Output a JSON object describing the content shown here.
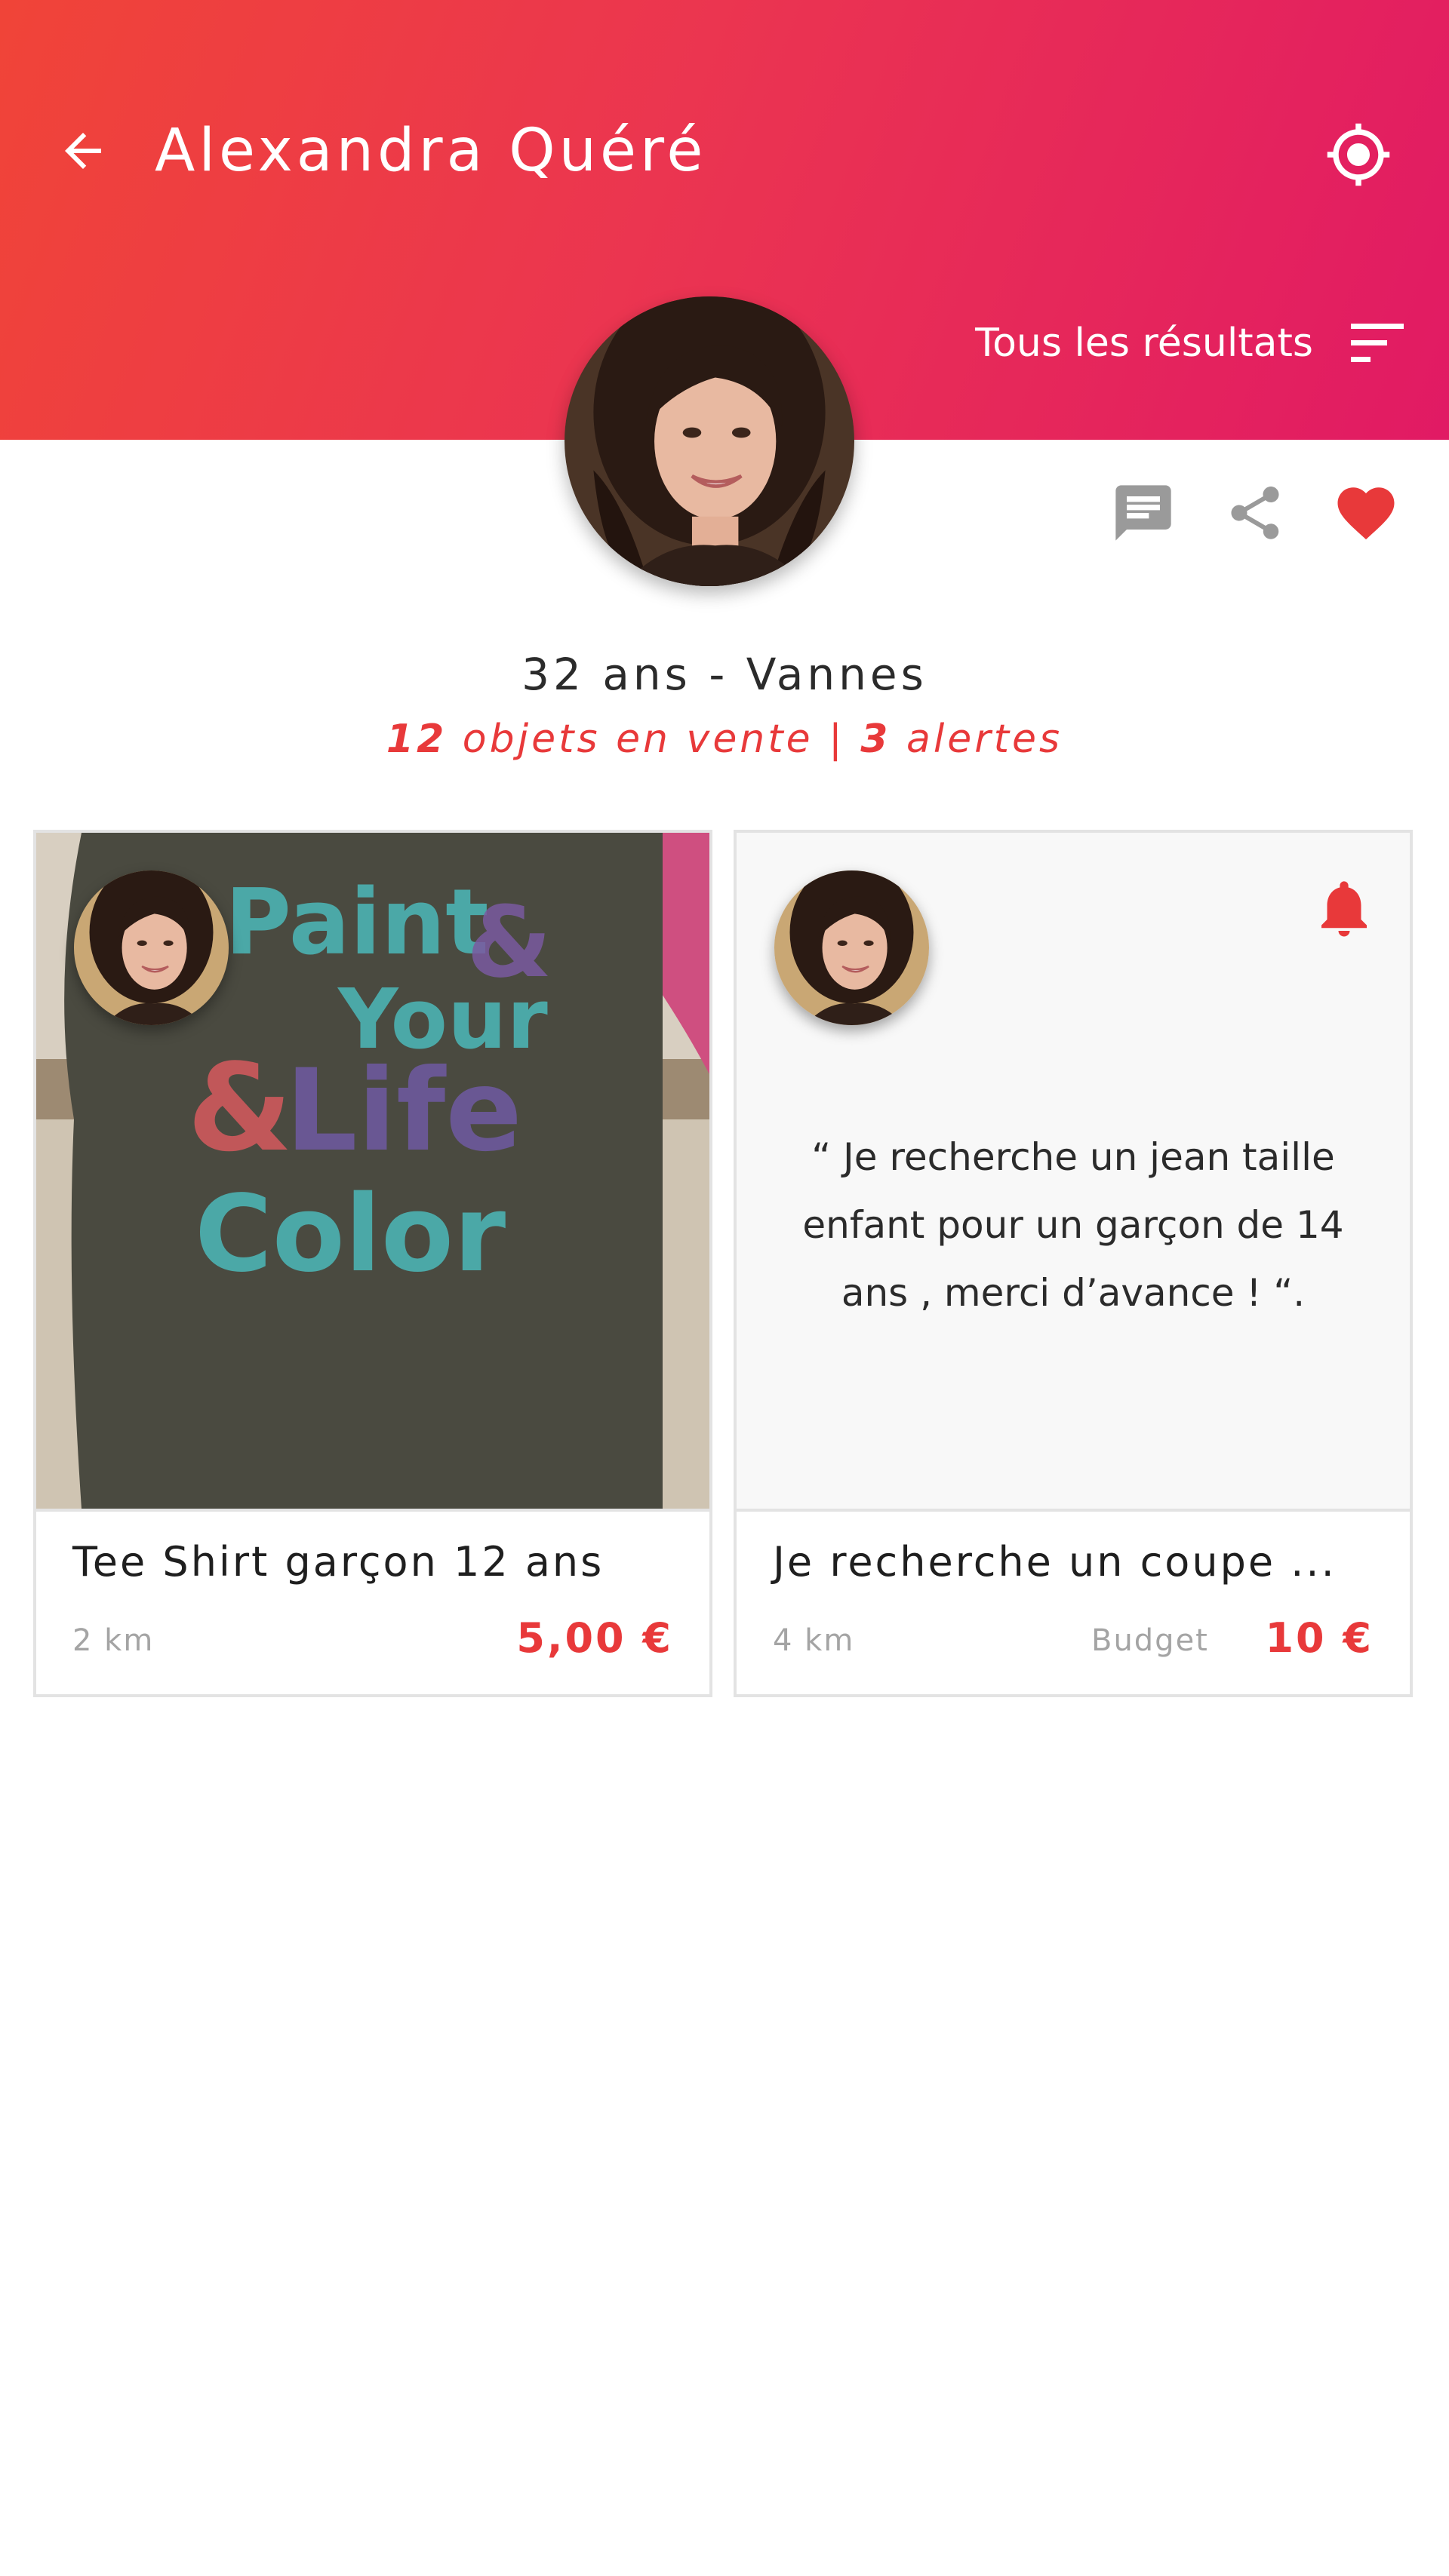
{
  "header": {
    "title": "Alexandra Quéré",
    "filter_label": "Tous les résultats",
    "icons": {
      "back": "arrow-left-icon",
      "locate": "my-location-icon",
      "filter": "sort-lines-icon"
    }
  },
  "profile": {
    "age_city": "32 ans - Vannes",
    "items_count": "12",
    "items_label": " objets en vente | ",
    "alerts_count": "3",
    "alerts_label": " alertes"
  },
  "actions": [
    {
      "name": "message",
      "icon": "message-icon"
    },
    {
      "name": "share",
      "icon": "share-icon"
    },
    {
      "name": "favorite",
      "icon": "heart-icon"
    }
  ],
  "cards": [
    {
      "type": "item",
      "media_text": [
        "Paint",
        "&",
        "Your",
        "Life",
        "Color"
      ],
      "title": "Tee Shirt garçon 12 ans",
      "distance": "2 km",
      "price": "5,00 €"
    },
    {
      "type": "alert",
      "quote": "“ Je recherche un jean taille enfant pour un garçon de 14 ans , merci d’avance ! “.",
      "title": "Je recherche un coupe ...",
      "distance": "4 km",
      "budget_label": "Budget",
      "price": "10 €"
    }
  ],
  "colors": {
    "header_start": "#f04438",
    "header_end": "#e11a64",
    "accent": "#e8393a",
    "icon_gray": "#9a9a9a",
    "card_border": "#e3e3e3"
  }
}
